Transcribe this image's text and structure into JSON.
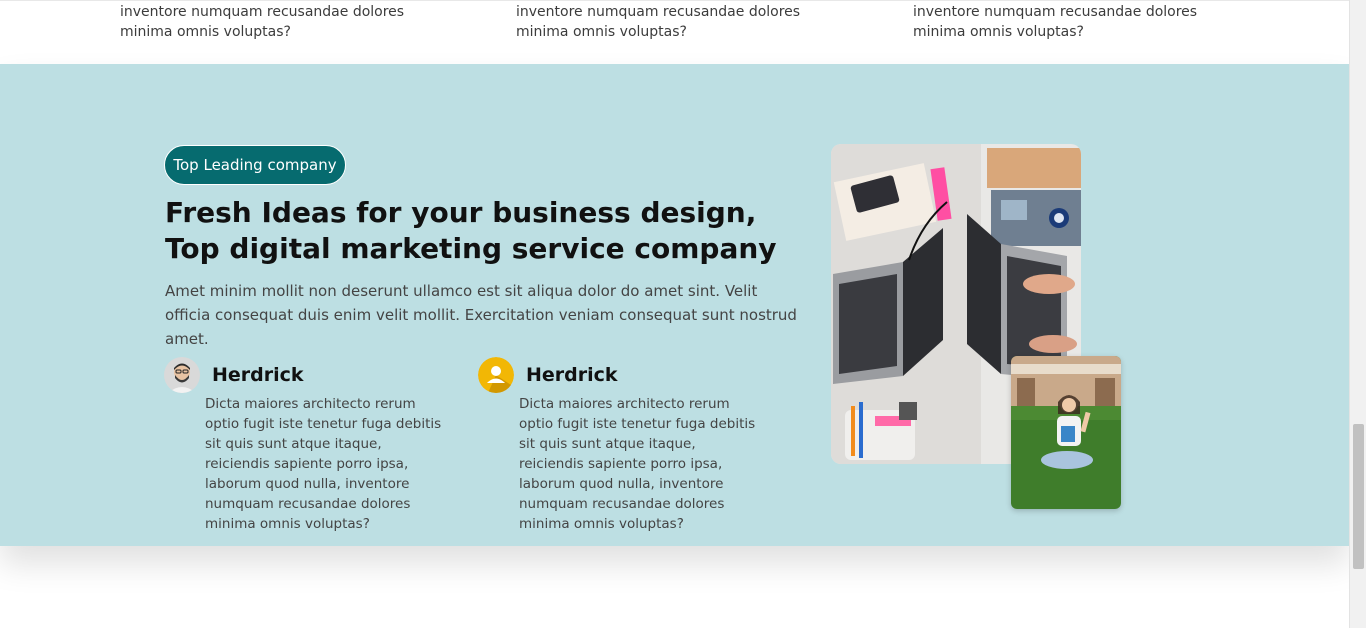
{
  "top_columns": [
    {
      "text": "inventore numquam recusandae dolores minima omnis voluptas?"
    },
    {
      "text": "inventore numquam recusandae dolores minima omnis voluptas?"
    },
    {
      "text": "inventore numquam recusandae dolores minima omnis voluptas?"
    }
  ],
  "section": {
    "badge": "Top Leading company",
    "heading": "Fresh Ideas for your business design, Top digital marketing service company",
    "lead": "Amet minim mollit non deserunt ullamco est sit aliqua dolor do amet sint. Velit officia consequat duis enim velit mollit. Exercitation veniam consequat sunt nostrud amet.",
    "features": [
      {
        "title": "Herdrick",
        "text": "Dicta maiores architecto rerum optio fugit iste tenetur fuga debitis sit quis sunt atque itaque, reiciendis sapiente porro ipsa, laborum quod nulla, inventore numquam recusandae dolores minima omnis voluptas?",
        "avatar_icon": "man-avatar-icon"
      },
      {
        "title": "Herdrick",
        "text": "Dicta maiores architecto rerum optio fugit iste tenetur fuga debitis sit quis sunt atque itaque, reiciendis sapiente porro ipsa, laborum quod nulla, inventore numquam recusandae dolores minima omnis voluptas?",
        "avatar_icon": "user-avatar-icon"
      }
    ],
    "colors": {
      "background": "#bddfe3",
      "badge": "#066b6f",
      "avatar_yellow": "#f2b705"
    }
  }
}
